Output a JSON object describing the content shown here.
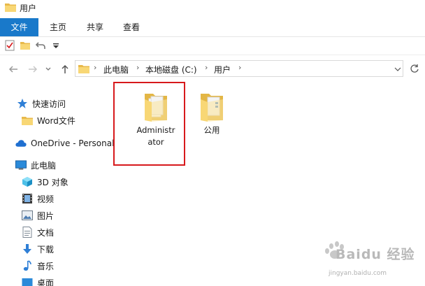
{
  "window": {
    "title": "用户"
  },
  "ribbon": {
    "tabs": [
      {
        "label": "文件",
        "active": true
      },
      {
        "label": "主页"
      },
      {
        "label": "共享"
      },
      {
        "label": "查看"
      }
    ]
  },
  "address": {
    "crumbs": [
      "此电脑",
      "本地磁盘 (C:)",
      "用户"
    ]
  },
  "sidebar": {
    "items": [
      {
        "label": "快速访问",
        "icon": "star-icon"
      },
      {
        "label": "Word文件",
        "icon": "folder-icon"
      },
      {
        "label": "OneDrive - Personal",
        "icon": "cloud-icon"
      },
      {
        "label": "此电脑",
        "icon": "computer-icon"
      },
      {
        "label": "3D 对象",
        "icon": "cube-icon"
      },
      {
        "label": "视频",
        "icon": "video-icon"
      },
      {
        "label": "图片",
        "icon": "picture-icon"
      },
      {
        "label": "文档",
        "icon": "document-icon"
      },
      {
        "label": "下载",
        "icon": "download-icon"
      },
      {
        "label": "音乐",
        "icon": "music-icon"
      },
      {
        "label": "桌面",
        "icon": "desktop-icon"
      }
    ]
  },
  "content": {
    "items": [
      {
        "name": "Administrator",
        "line1": "Administr",
        "line2": "ator"
      },
      {
        "name": "公用"
      }
    ]
  },
  "watermark": {
    "brand": "Baidu 经验",
    "url": "jingyan.baidu.com"
  },
  "colors": {
    "accent": "#1979ca",
    "highlight": "#d7191c",
    "folder": "#f8d775"
  }
}
